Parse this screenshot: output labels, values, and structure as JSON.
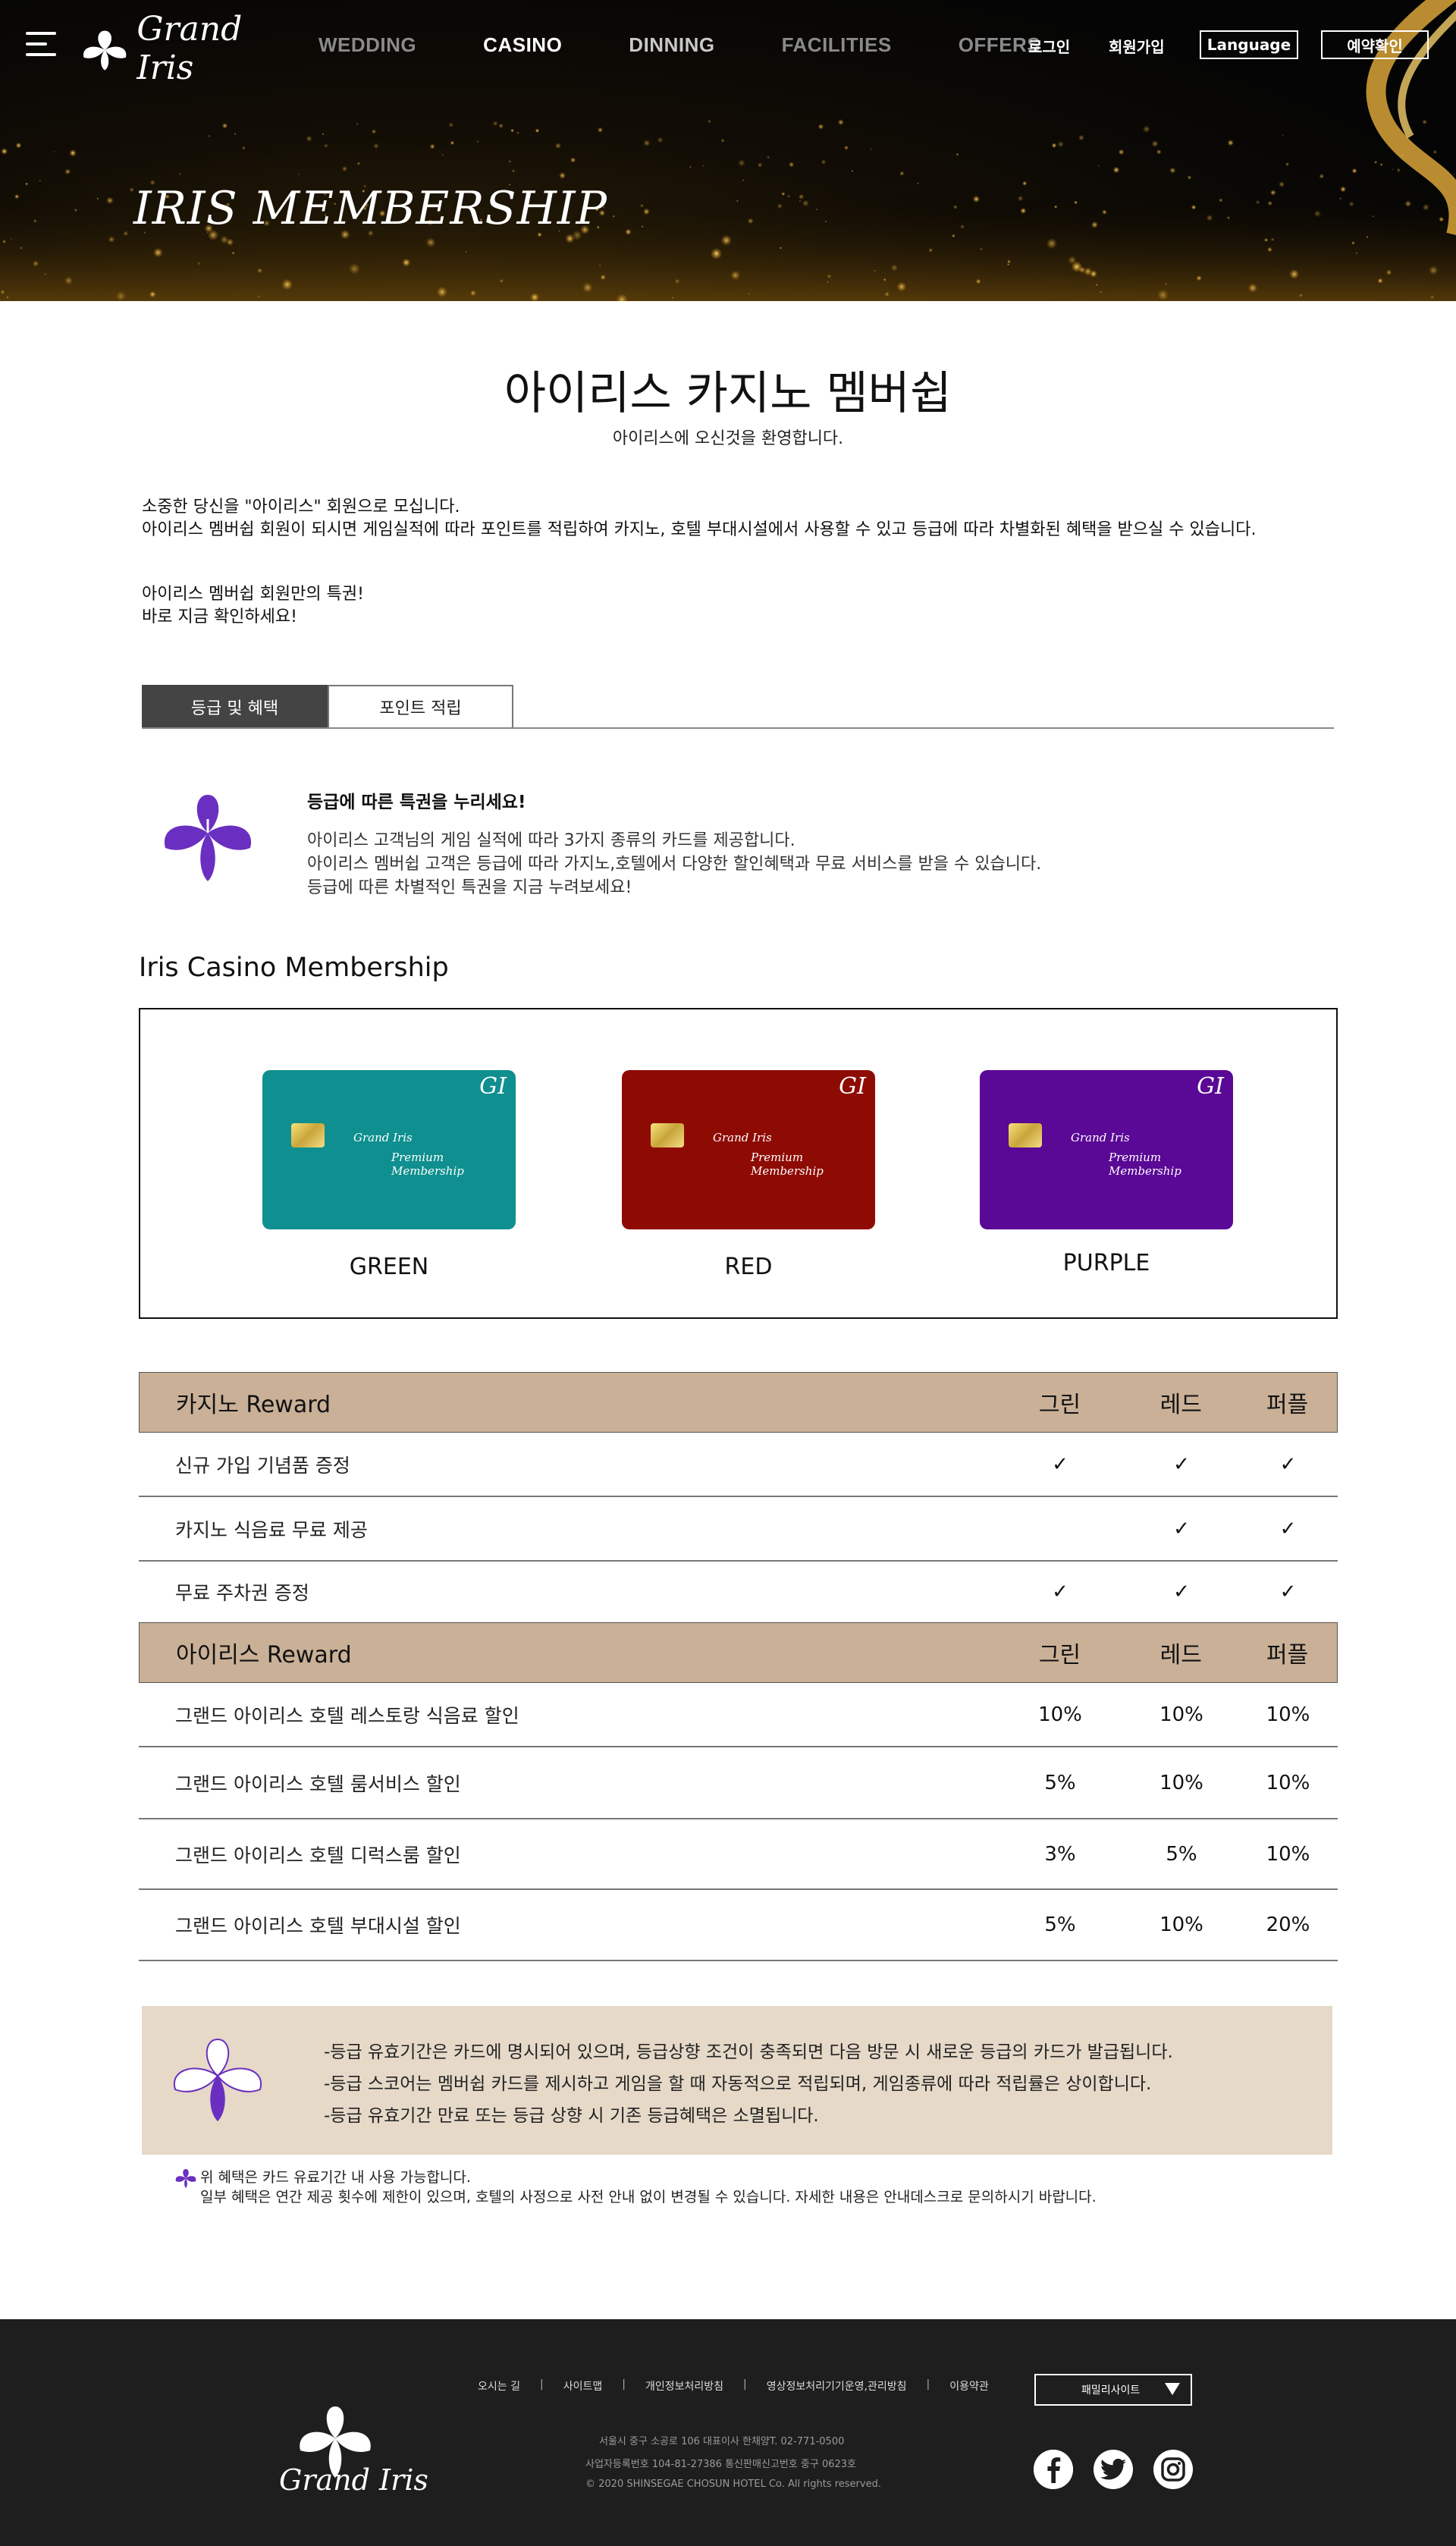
{
  "nav": {
    "logo_text": "Grand Iris",
    "menu": [
      "WEDDING",
      "CASINO",
      "DINNING",
      "FACILITIES",
      "OFFERS"
    ],
    "login": "로그인",
    "join": "회원가입",
    "language": "Language",
    "reservation": "예약확인"
  },
  "hero": {
    "title": "IRIS MEMBERSHIP"
  },
  "header": {
    "title": "아이리스 카지노 멤버쉽",
    "subtitle": "아이리스에 오신것을 환영합니다."
  },
  "intro": {
    "line1": "소중한 당신을 \"아이리스\" 회원으로 모십니다.",
    "line2": "아이리스 멤버쉽 회원이 되시면 게임실적에 따라 포인트를 적립하여 카지노, 호텔 부대시설에서 사용할 수 있고 등급에 따라 차별화된 혜택을 받으실 수 있습니다.",
    "line3": "아이리스 멤버쉽 회원만의 특권!",
    "line4": "바로 지금 확인하세요!"
  },
  "tabs": [
    {
      "label": "등급 및 혜택"
    },
    {
      "label": "포인트 적립"
    }
  ],
  "benefit": {
    "heading": "등급에 따른 특권을 누리세요!",
    "line1": "아이리스 고객님의 게임 실적에 따라 3가지 종류의 카드를 제공합니다.",
    "line2": "아이리스 멤버쉽 고객은 등급에 따라 가지노,호텔에서 다양한 할인혜택과 무료 서비스를 받을 수 있습니다.",
    "line3": "등급에 따른 차별적인 특권을 지금 누려보세요!"
  },
  "membership": {
    "title": "Iris Casino Membership",
    "cards": [
      {
        "label": "GREEN",
        "color": "#0f8f8f",
        "monogram": "GI",
        "brand": "Grand Iris",
        "sub": "Premium Membership"
      },
      {
        "label": "RED",
        "color": "#8e0b04",
        "monogram": "GI",
        "brand": "Grand Iris",
        "sub": "Premium Membership"
      },
      {
        "label": "PURPLE",
        "color": "#5a0896",
        "monogram": "GI",
        "brand": "Grand Iris",
        "sub": "Premium Membership"
      }
    ]
  },
  "casino_reward": {
    "title": "카지노 Reward",
    "cols": [
      "그린",
      "레드",
      "퍼플"
    ],
    "rows": [
      {
        "label": "신규 가입 기념품 증정",
        "values": [
          "✓",
          "✓",
          "✓"
        ]
      },
      {
        "label": "카지노 식음료 무료 제공",
        "values": [
          "",
          "✓",
          "✓"
        ]
      },
      {
        "label": "무료 주차권 증정",
        "values": [
          "✓",
          "✓",
          "✓"
        ]
      }
    ]
  },
  "iris_reward": {
    "title": "아이리스 Reward",
    "cols": [
      "그린",
      "레드",
      "퍼플"
    ],
    "rows": [
      {
        "label": "그랜드 아이리스 호텔 레스토랑 식음료 할인",
        "values": [
          "10%",
          "10%",
          "10%"
        ]
      },
      {
        "label": "그랜드 아이리스 호텔 룸서비스 할인",
        "values": [
          "5%",
          "10%",
          "10%"
        ]
      },
      {
        "label": "그랜드 아이리스 호텔 디럭스룸 할인",
        "values": [
          "3%",
          "5%",
          "10%"
        ]
      },
      {
        "label": "그랜드 아이리스 호텔 부대시설 할인",
        "values": [
          "5%",
          "10%",
          "20%"
        ]
      }
    ]
  },
  "notice": {
    "line1": "-등급 유효기간은 카드에 명시되어 있으며, 등급상향 조건이 충족되면 다음 방문 시 새로운 등급의 카드가 발급됩니다.",
    "line2": "-등급 스코어는 멤버쉽 카드를 제시하고 게임을 할 때 자동적으로 적립되며, 게임종류에 따라 적립률은 상이합니다.",
    "line3": "-등급 유효기간 만료 또는 등급 상향 시 기존 등급혜택은 소멸됩니다."
  },
  "fineprint": {
    "line1": "위 혜택은 카드 유료기간 내 사용 가능합니다.",
    "line2": "일부 혜택은 연간 제공 횟수에 제한이 있으며, 호텔의 사정으로 사전 안내 없이 변경될 수 있습니다. 자세한 내용은 안내데스크로 문의하시기 바랍니다."
  },
  "footer": {
    "logo_text": "Grand Iris",
    "links": [
      "오시는 길",
      "사이트맵",
      "개인정보처리방침",
      "영상정보처리기기운영,관리방침",
      "이용약관"
    ],
    "address": "서울시 중구 소공로 106 대표이사 한채양T. 02-771-0500",
    "business": "사업자등록번호 104-81-27386 통신판매신고번호 중구 0623호",
    "copyright": "© 2020 SHINSEGAE CHOSUN HOTEL Co. All rights reserved.",
    "family_site": "패밀리사이트"
  },
  "colors": {
    "tab_active": "#444444",
    "table_header": "#c9b097",
    "notice_bg": "#e6d9c8",
    "iris_purple": "#6a2fc0",
    "footer_bg": "#1e1e1e"
  }
}
